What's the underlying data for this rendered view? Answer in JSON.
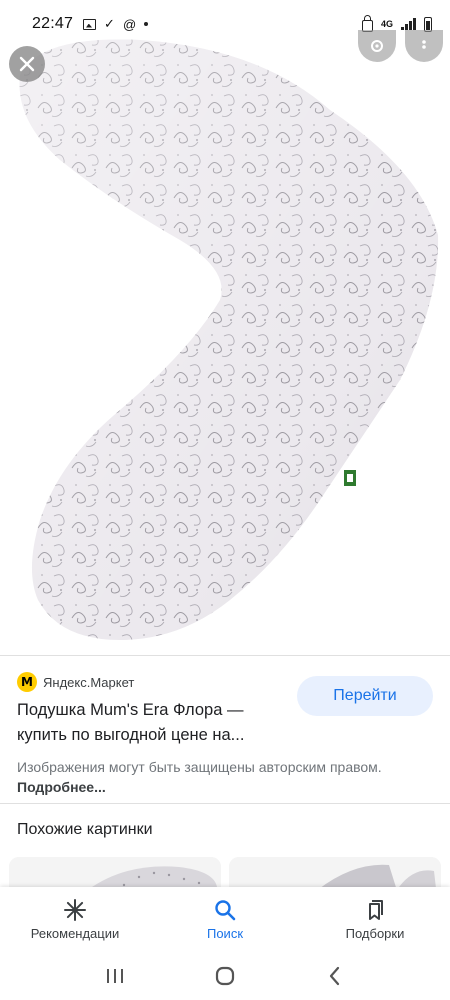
{
  "status_bar": {
    "time": "22:47",
    "network": "4G"
  },
  "viewer": {
    "image_subject": "pillow-photo"
  },
  "result": {
    "source_name": "Яндекс.Маркет",
    "title_line1": "Подушка Mum's Era Флора —",
    "title_line2": "купить по выгодной цене на...",
    "visit_button": "Перейти",
    "notice_text": "Изображения могут быть защищены авторским правом.",
    "notice_link": "Подробнее..."
  },
  "similar": {
    "title": "Похожие картинки"
  },
  "bottom_nav": {
    "items": [
      {
        "label": "Рекомендации",
        "icon": "asterisk-icon"
      },
      {
        "label": "Поиск",
        "icon": "search-icon"
      },
      {
        "label": "Подборки",
        "icon": "bookmarks-icon"
      }
    ],
    "active_index": 1
  },
  "colors": {
    "accent": "#1a73e8",
    "button_bg": "#e8f0fe",
    "yandex_yellow": "#ffcc00"
  }
}
